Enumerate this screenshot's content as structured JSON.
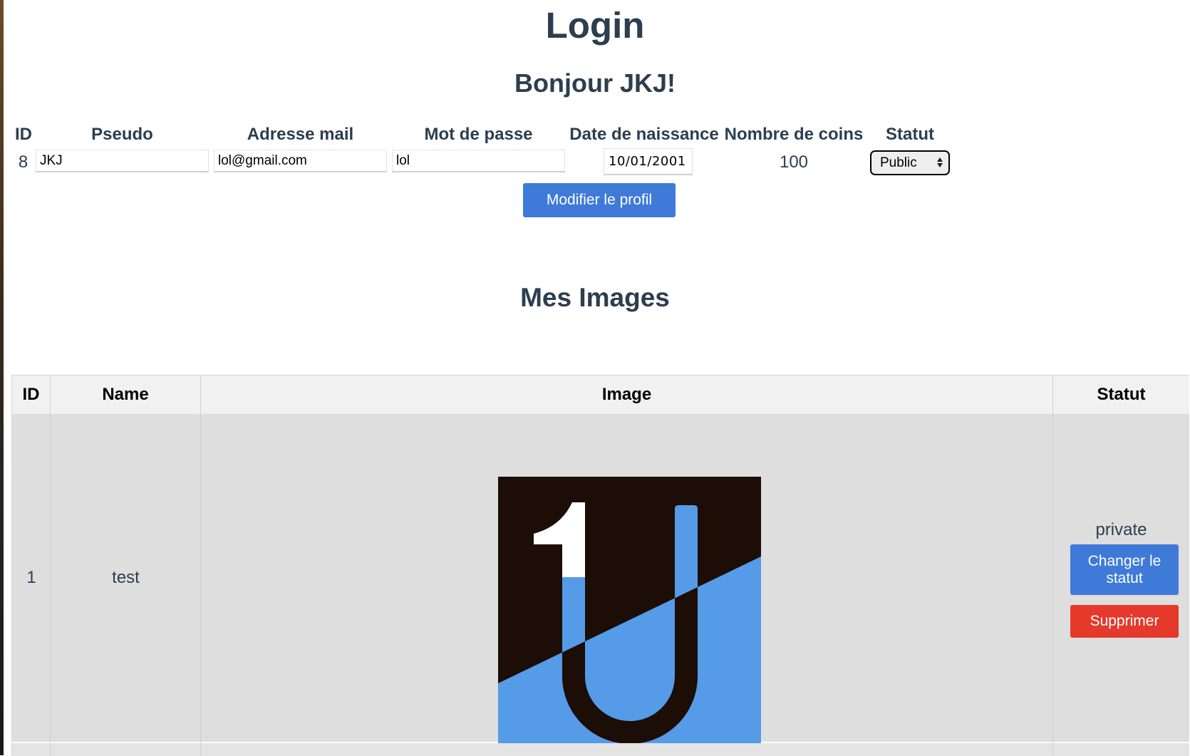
{
  "page": {
    "title": "Login",
    "greeting": "Bonjour JKJ!"
  },
  "profile": {
    "headers": {
      "id": "ID",
      "pseudo": "Pseudo",
      "email": "Adresse mail",
      "password": "Mot de passe",
      "birthdate": "Date de naissance",
      "coins": "Nombre de coins",
      "status": "Statut"
    },
    "id": "8",
    "pseudo": "JKJ",
    "email": "lol@gmail.com",
    "password": "lol",
    "birthdate": "10/01/2001",
    "coins": "100",
    "status_selected": "Public",
    "submit_label": "Modifier le profil"
  },
  "images_section": {
    "title": "Mes Images",
    "headers": {
      "id": "ID",
      "name": "Name",
      "image": "Image",
      "status": "Statut"
    },
    "rows": [
      {
        "id": "1",
        "name": "test",
        "image_icon": "u-logo-icon",
        "status": "private",
        "change_label": "Changer le statut",
        "delete_label": "Supprimer"
      }
    ]
  },
  "colors": {
    "primary_button": "#3f7ad8",
    "danger_button": "#e5392b",
    "heading": "#2c3e50",
    "logo_blue": "#569be8",
    "logo_dark": "#1c0d06"
  }
}
